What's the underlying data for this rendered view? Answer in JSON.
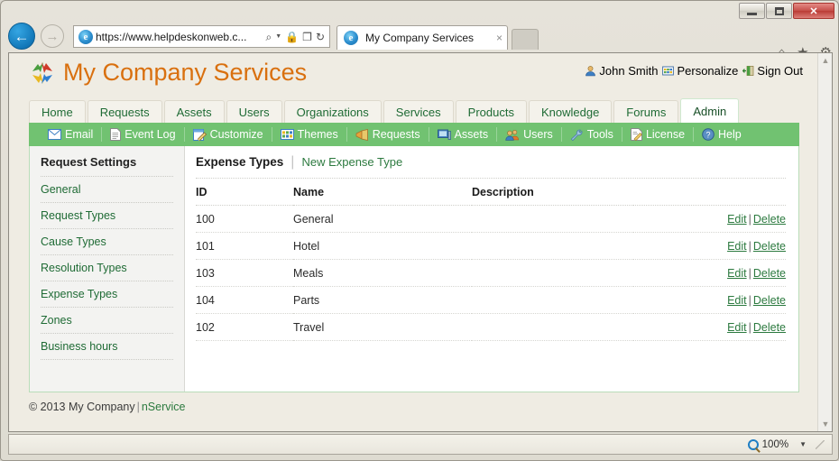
{
  "browser": {
    "back_label": "←",
    "forward_label": "→",
    "url": "https://www.helpdeskonweb.c...",
    "search_icon": "⌕",
    "caret_icon": "▼",
    "lock_icon": "🔒",
    "compat_icon": "❐",
    "refresh_icon": "↻",
    "tab_title": "My Company Services",
    "tab_close": "×",
    "ie_mark": "e",
    "home_icon": "⌂",
    "star_icon": "★",
    "gear_icon": "⚙",
    "minimize_label": "",
    "maximize_label": "",
    "close_label": "✕"
  },
  "site": {
    "title": "My Company Services",
    "logo_name": "four-arrows-logo"
  },
  "user_links": [
    {
      "label": "John Smith",
      "icon": "user-icon"
    },
    {
      "label": "Personalize",
      "icon": "grid-icon"
    },
    {
      "label": "Sign Out",
      "icon": "exit-door-icon"
    }
  ],
  "main_tabs": [
    {
      "label": "Home",
      "active": false
    },
    {
      "label": "Requests",
      "active": false
    },
    {
      "label": "Assets",
      "active": false
    },
    {
      "label": "Users",
      "active": false
    },
    {
      "label": "Organizations",
      "active": false
    },
    {
      "label": "Services",
      "active": false
    },
    {
      "label": "Products",
      "active": false
    },
    {
      "label": "Knowledge",
      "active": false
    },
    {
      "label": "Forums",
      "active": false
    },
    {
      "label": "Admin",
      "active": true
    }
  ],
  "toolbar": [
    {
      "label": "Email",
      "icon": "envelope-icon"
    },
    {
      "label": "Event Log",
      "icon": "document-icon"
    },
    {
      "label": "Customize",
      "icon": "pencil-page-icon"
    },
    {
      "label": "Themes",
      "icon": "palette-grid-icon"
    },
    {
      "label": "Requests",
      "icon": "megaphone-icon"
    },
    {
      "label": "Assets",
      "icon": "monitor-icon"
    },
    {
      "label": "Users",
      "icon": "people-icon"
    },
    {
      "label": "Tools",
      "icon": "wrench-icon"
    },
    {
      "label": "License",
      "icon": "certificate-icon"
    },
    {
      "label": "Help",
      "icon": "question-circle-icon"
    }
  ],
  "sidebar": {
    "heading": "Request Settings",
    "items": [
      {
        "label": "General"
      },
      {
        "label": "Request Types"
      },
      {
        "label": "Cause Types"
      },
      {
        "label": "Resolution Types"
      },
      {
        "label": "Expense Types"
      },
      {
        "label": "Zones"
      },
      {
        "label": "Business hours"
      }
    ]
  },
  "content": {
    "title": "Expense Types",
    "divider": "|",
    "new_link": "New Expense Type",
    "columns": [
      "ID",
      "Name",
      "Description"
    ],
    "rows": [
      {
        "id": "100",
        "name": "General",
        "description": "",
        "edit": "Edit",
        "delete": "Delete"
      },
      {
        "id": "101",
        "name": "Hotel",
        "description": "",
        "edit": "Edit",
        "delete": "Delete"
      },
      {
        "id": "103",
        "name": "Meals",
        "description": "",
        "edit": "Edit",
        "delete": "Delete"
      },
      {
        "id": "104",
        "name": "Parts",
        "description": "",
        "edit": "Edit",
        "delete": "Delete"
      },
      {
        "id": "102",
        "name": "Travel",
        "description": "",
        "edit": "Edit",
        "delete": "Delete"
      }
    ],
    "action_separator": "|"
  },
  "footer": {
    "copyright": "© 2013 My Company",
    "separator": "|",
    "product_link": "nService"
  },
  "status": {
    "zoom_level": "100%",
    "zoom_caret": "▼"
  },
  "scrollbar": {
    "up_arrow": "▲",
    "down_arrow": "▼"
  },
  "colors": {
    "brand_orange": "#d9700f",
    "toolbar_green": "#71c271",
    "link_green": "#2c7a3f",
    "page_bg": "#efece3"
  }
}
